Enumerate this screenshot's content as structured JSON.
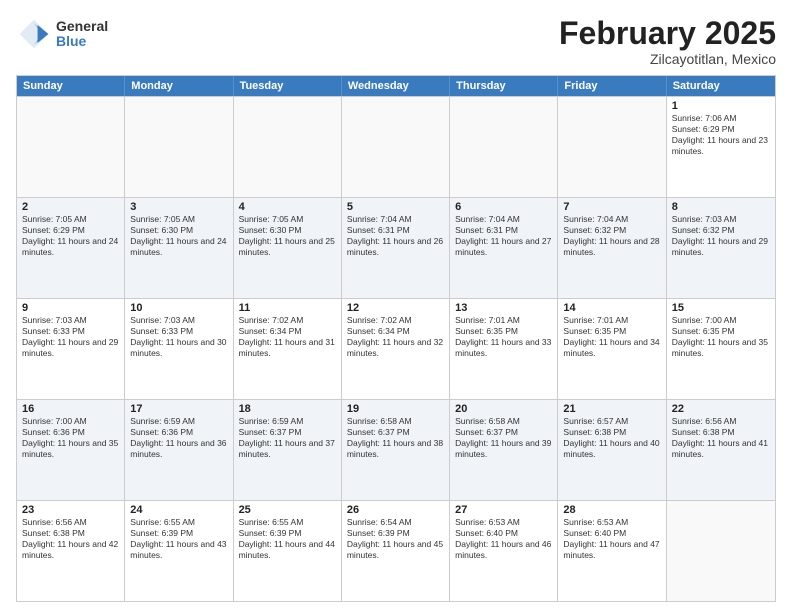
{
  "logo": {
    "general": "General",
    "blue": "Blue"
  },
  "title": "February 2025",
  "subtitle": "Zilcayotitlan, Mexico",
  "days": [
    "Sunday",
    "Monday",
    "Tuesday",
    "Wednesday",
    "Thursday",
    "Friday",
    "Saturday"
  ],
  "weeks": [
    [
      {
        "day": "",
        "info": ""
      },
      {
        "day": "",
        "info": ""
      },
      {
        "day": "",
        "info": ""
      },
      {
        "day": "",
        "info": ""
      },
      {
        "day": "",
        "info": ""
      },
      {
        "day": "",
        "info": ""
      },
      {
        "day": "1",
        "info": "Sunrise: 7:06 AM\nSunset: 6:29 PM\nDaylight: 11 hours and 23 minutes."
      }
    ],
    [
      {
        "day": "2",
        "info": "Sunrise: 7:05 AM\nSunset: 6:29 PM\nDaylight: 11 hours and 24 minutes."
      },
      {
        "day": "3",
        "info": "Sunrise: 7:05 AM\nSunset: 6:30 PM\nDaylight: 11 hours and 24 minutes."
      },
      {
        "day": "4",
        "info": "Sunrise: 7:05 AM\nSunset: 6:30 PM\nDaylight: 11 hours and 25 minutes."
      },
      {
        "day": "5",
        "info": "Sunrise: 7:04 AM\nSunset: 6:31 PM\nDaylight: 11 hours and 26 minutes."
      },
      {
        "day": "6",
        "info": "Sunrise: 7:04 AM\nSunset: 6:31 PM\nDaylight: 11 hours and 27 minutes."
      },
      {
        "day": "7",
        "info": "Sunrise: 7:04 AM\nSunset: 6:32 PM\nDaylight: 11 hours and 28 minutes."
      },
      {
        "day": "8",
        "info": "Sunrise: 7:03 AM\nSunset: 6:32 PM\nDaylight: 11 hours and 29 minutes."
      }
    ],
    [
      {
        "day": "9",
        "info": "Sunrise: 7:03 AM\nSunset: 6:33 PM\nDaylight: 11 hours and 29 minutes."
      },
      {
        "day": "10",
        "info": "Sunrise: 7:03 AM\nSunset: 6:33 PM\nDaylight: 11 hours and 30 minutes."
      },
      {
        "day": "11",
        "info": "Sunrise: 7:02 AM\nSunset: 6:34 PM\nDaylight: 11 hours and 31 minutes."
      },
      {
        "day": "12",
        "info": "Sunrise: 7:02 AM\nSunset: 6:34 PM\nDaylight: 11 hours and 32 minutes."
      },
      {
        "day": "13",
        "info": "Sunrise: 7:01 AM\nSunset: 6:35 PM\nDaylight: 11 hours and 33 minutes."
      },
      {
        "day": "14",
        "info": "Sunrise: 7:01 AM\nSunset: 6:35 PM\nDaylight: 11 hours and 34 minutes."
      },
      {
        "day": "15",
        "info": "Sunrise: 7:00 AM\nSunset: 6:35 PM\nDaylight: 11 hours and 35 minutes."
      }
    ],
    [
      {
        "day": "16",
        "info": "Sunrise: 7:00 AM\nSunset: 6:36 PM\nDaylight: 11 hours and 35 minutes."
      },
      {
        "day": "17",
        "info": "Sunrise: 6:59 AM\nSunset: 6:36 PM\nDaylight: 11 hours and 36 minutes."
      },
      {
        "day": "18",
        "info": "Sunrise: 6:59 AM\nSunset: 6:37 PM\nDaylight: 11 hours and 37 minutes."
      },
      {
        "day": "19",
        "info": "Sunrise: 6:58 AM\nSunset: 6:37 PM\nDaylight: 11 hours and 38 minutes."
      },
      {
        "day": "20",
        "info": "Sunrise: 6:58 AM\nSunset: 6:37 PM\nDaylight: 11 hours and 39 minutes."
      },
      {
        "day": "21",
        "info": "Sunrise: 6:57 AM\nSunset: 6:38 PM\nDaylight: 11 hours and 40 minutes."
      },
      {
        "day": "22",
        "info": "Sunrise: 6:56 AM\nSunset: 6:38 PM\nDaylight: 11 hours and 41 minutes."
      }
    ],
    [
      {
        "day": "23",
        "info": "Sunrise: 6:56 AM\nSunset: 6:38 PM\nDaylight: 11 hours and 42 minutes."
      },
      {
        "day": "24",
        "info": "Sunrise: 6:55 AM\nSunset: 6:39 PM\nDaylight: 11 hours and 43 minutes."
      },
      {
        "day": "25",
        "info": "Sunrise: 6:55 AM\nSunset: 6:39 PM\nDaylight: 11 hours and 44 minutes."
      },
      {
        "day": "26",
        "info": "Sunrise: 6:54 AM\nSunset: 6:39 PM\nDaylight: 11 hours and 45 minutes."
      },
      {
        "day": "27",
        "info": "Sunrise: 6:53 AM\nSunset: 6:40 PM\nDaylight: 11 hours and 46 minutes."
      },
      {
        "day": "28",
        "info": "Sunrise: 6:53 AM\nSunset: 6:40 PM\nDaylight: 11 hours and 47 minutes."
      },
      {
        "day": "",
        "info": ""
      }
    ]
  ]
}
